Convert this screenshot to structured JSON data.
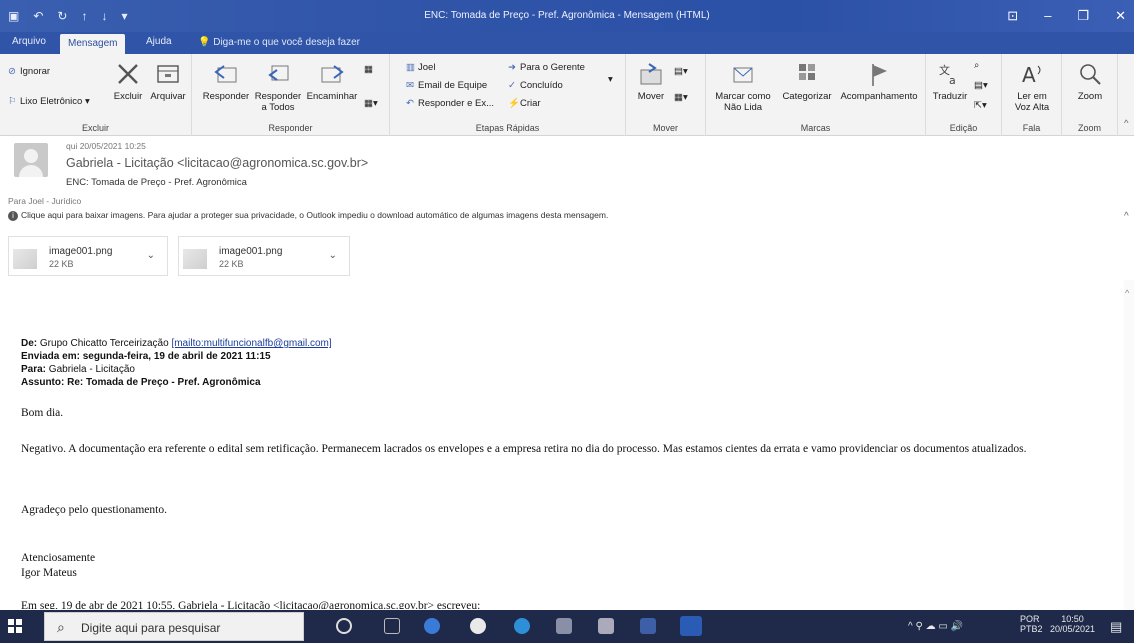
{
  "window": {
    "title": "ENC: Tomada de Preço - Pref. Agronômica  -  Mensagem (HTML)"
  },
  "ribbon_tabs": [
    {
      "label": "Arquivo"
    },
    {
      "label": "Mensagem"
    },
    {
      "label": "Ajuda"
    }
  ],
  "tell_me": "Diga-me o que você deseja fazer",
  "groups": {
    "excluir": {
      "label": "Excluir",
      "ignorar": "Ignorar",
      "lixo": "Lixo Eletrônico",
      "excluir_btn": "Excluir",
      "arquivar": "Arquivar"
    },
    "responder": {
      "label": "Responder",
      "responder": "Responder",
      "responder_todos_1": "Responder",
      "responder_todos_2": "a Todos",
      "encaminhar": "Encaminhar"
    },
    "etapas": {
      "label": "Etapas Rápidas",
      "joel": "Joel",
      "email_equipe": "Email de Equipe",
      "responder_ex": "Responder e Ex...",
      "para_gerente": "Para o Gerente",
      "concluido": "Concluído",
      "criar": "Criar"
    },
    "mover": {
      "label": "Mover",
      "mover_btn": "Mover"
    },
    "marcas": {
      "label": "Marcas",
      "marcar_1": "Marcar como",
      "marcar_2": "Não Lida",
      "categorizar": "Categorizar",
      "acompanhamento": "Acompanhamento"
    },
    "edicao": {
      "label": "Edição",
      "traduzir": "Traduzir"
    },
    "fala": {
      "label": "Fala",
      "ler_1": "Ler em",
      "ler_2": "Voz Alta"
    },
    "zoom": {
      "label": "Zoom",
      "zoom_btn": "Zoom"
    }
  },
  "header": {
    "date": "qui 20/05/2021 10:25",
    "from": "Gabriela - Licitação <licitacao@agronomica.sc.gov.br>",
    "subject": "ENC: Tomada de Preço - Pref. Agronômica",
    "to": "Para   Joel - Jurídico",
    "info": "Clique aqui para baixar imagens. Para ajudar a proteger sua privacidade, o Outlook impediu o download automático de algumas imagens desta mensagem."
  },
  "attachments": [
    {
      "name": "image001.png",
      "size": "22 KB"
    },
    {
      "name": "image001.png",
      "size": "22 KB"
    }
  ],
  "forward": {
    "de_label": "De:",
    "de_value": "Grupo Chicatto Terceirização",
    "de_link": "[mailto:multifuncionalfb@gmail.com]",
    "enviada_label": "Enviada em:",
    "enviada_value": "segunda-feira, 19 de abril de 2021 11:15",
    "para_label": "Para:",
    "para_value": "Gabriela - Licitação",
    "assunto_label": "Assunto:",
    "assunto_value": "Re: Tomada de Preço - Pref. Agronômica"
  },
  "body": {
    "greeting": "Bom dia.",
    "paragraph": "Negativo. A documentação era referente o edital sem retificação. Permanecem lacrados os envelopes e a empresa retira no dia do processo. Mas estamos cientes da errata e vamo providenciar os documentos atualizados.",
    "thanks": "Agradeço pelo questionamento.",
    "closing": "Atenciosamente",
    "signature": "Igor Mateus",
    "quoted": "Em seg, 19 de abr de 2021 10:55, Gabriela - Licitação <licitacao@agronomica.sc.gov.br> escreveu:"
  },
  "taskbar": {
    "search_placeholder": "Digite aqui para pesquisar",
    "lang_1": "POR",
    "lang_2": "PTB2",
    "time": "10:50",
    "date": "20/05/2021"
  }
}
